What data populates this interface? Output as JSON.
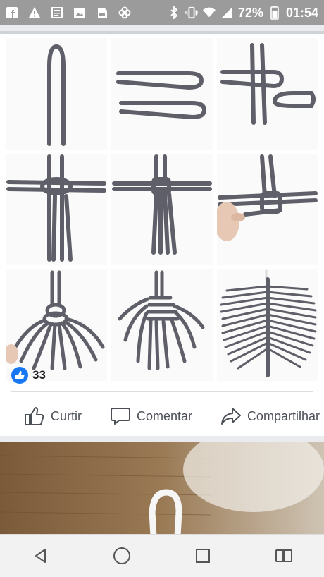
{
  "status_bar": {
    "battery_percent": "72%",
    "time": "01:54",
    "left_icons": [
      "facebook-icon",
      "warning-icon",
      "news-icon",
      "gallery-icon",
      "sim-icon",
      "pinwheel-icon"
    ],
    "right_icons": [
      "bluetooth-icon",
      "vibrate-icon",
      "wifi-icon",
      "signal-icon",
      "battery-icon"
    ]
  },
  "post": {
    "reaction_count": "33",
    "actions": {
      "like_label": "Curtir",
      "comment_label": "Comentar",
      "share_label": "Compartilhar"
    }
  },
  "nav_bar": {
    "buttons": [
      "back-icon",
      "home-icon",
      "recents-icon",
      "sim-switch-icon"
    ]
  },
  "colors": {
    "status_bar": "#9b9b9b",
    "like_blue": "#1877f2",
    "action_text": "#4b4f56",
    "rope": "#5e5f68"
  }
}
